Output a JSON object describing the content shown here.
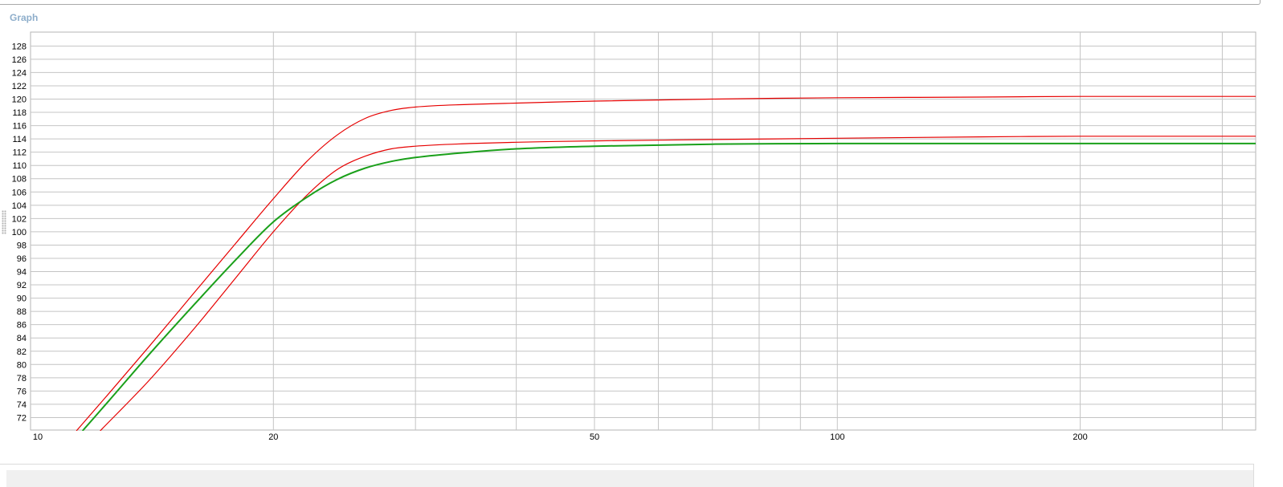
{
  "panel": {
    "title": "Graph"
  },
  "chart_data": {
    "type": "line",
    "title": "",
    "xlabel": "",
    "ylabel": "",
    "xscale": "log",
    "xlim": [
      10,
      330
    ],
    "ylim": [
      70,
      130
    ],
    "grid": true,
    "legend": "none",
    "x_tick_labels": [
      "10",
      "20",
      "50",
      "100",
      "200"
    ],
    "x_tick_values": [
      10,
      20,
      50,
      100,
      200
    ],
    "x_gridlines": [
      20,
      30,
      40,
      50,
      60,
      70,
      80,
      90,
      100,
      200,
      300
    ],
    "y_tick_labels": [
      "72",
      "74",
      "76",
      "78",
      "80",
      "82",
      "84",
      "86",
      "88",
      "90",
      "92",
      "94",
      "96",
      "98",
      "100",
      "102",
      "104",
      "106",
      "108",
      "110",
      "112",
      "114",
      "116",
      "118",
      "120",
      "122",
      "124",
      "126",
      "128"
    ],
    "series": [
      {
        "color": "#e60000",
        "x": [
          11.4,
          12.5,
          14,
          16,
          18,
          20,
          22,
          24,
          26,
          28,
          30,
          35,
          40,
          50,
          70,
          100,
          150,
          200,
          330
        ],
        "y": [
          70,
          75.6,
          82.6,
          91.0,
          98.4,
          105.0,
          110.6,
          114.6,
          117.1,
          118.3,
          118.8,
          119.2,
          119.4,
          119.7,
          120.0,
          120.2,
          120.3,
          120.4,
          120.4
        ]
      },
      {
        "color": "#e60000",
        "x": [
          12.2,
          14,
          16,
          18,
          20,
          22,
          24,
          26,
          28,
          30,
          35,
          40,
          50,
          70,
          100,
          150,
          200,
          330
        ],
        "y": [
          70,
          77.5,
          85.6,
          93.2,
          100.0,
          105.5,
          109.4,
          111.4,
          112.5,
          112.9,
          113.3,
          113.5,
          113.7,
          113.9,
          114.1,
          114.3,
          114.4,
          114.4
        ]
      },
      {
        "color": "#1aa01a",
        "x": [
          11.6,
          12.5,
          14,
          16,
          18,
          20,
          22,
          24,
          26,
          28,
          30,
          35,
          40,
          50,
          70,
          100,
          150,
          200,
          330
        ],
        "y": [
          70,
          74.5,
          81.4,
          89.2,
          95.9,
          101.5,
          105.2,
          107.9,
          109.6,
          110.6,
          111.2,
          112.0,
          112.5,
          112.9,
          113.2,
          113.3,
          113.3,
          113.3,
          113.3
        ]
      }
    ]
  }
}
